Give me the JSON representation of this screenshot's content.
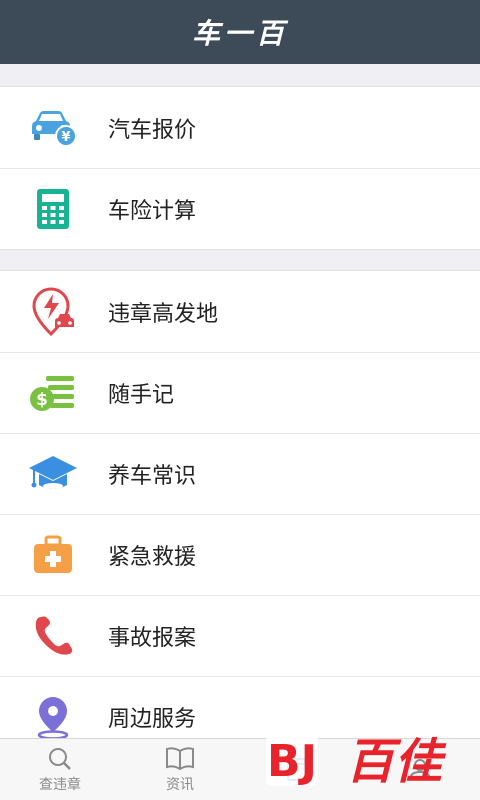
{
  "header": {
    "title": "车一百"
  },
  "menu_groups": [
    {
      "items": [
        {
          "label": "汽车报价",
          "icon": "car-price-icon"
        },
        {
          "label": "车险计算",
          "icon": "calculator-icon"
        }
      ]
    },
    {
      "items": [
        {
          "label": "违章高发地",
          "icon": "violation-location-icon"
        },
        {
          "label": "随手记",
          "icon": "money-notes-icon"
        },
        {
          "label": "养车常识",
          "icon": "graduation-cap-icon"
        },
        {
          "label": "紧急救援",
          "icon": "first-aid-kit-icon"
        },
        {
          "label": "事故报案",
          "icon": "phone-icon"
        },
        {
          "label": "周边服务",
          "icon": "location-pin-icon"
        }
      ]
    }
  ],
  "tabbar": {
    "tabs": [
      {
        "label": "查违章",
        "icon": "search-icon"
      },
      {
        "label": "资讯",
        "icon": "book-icon"
      },
      {
        "label": "",
        "icon": "toolbox-icon"
      },
      {
        "label": "",
        "icon": "user-icon"
      }
    ]
  },
  "colors": {
    "header_bg": "#3d4a58",
    "active_tab": "#3b8fe0",
    "watermark_red": "#e8232b"
  },
  "watermark": {
    "text": "百佳",
    "logo_letters": "BJ"
  }
}
